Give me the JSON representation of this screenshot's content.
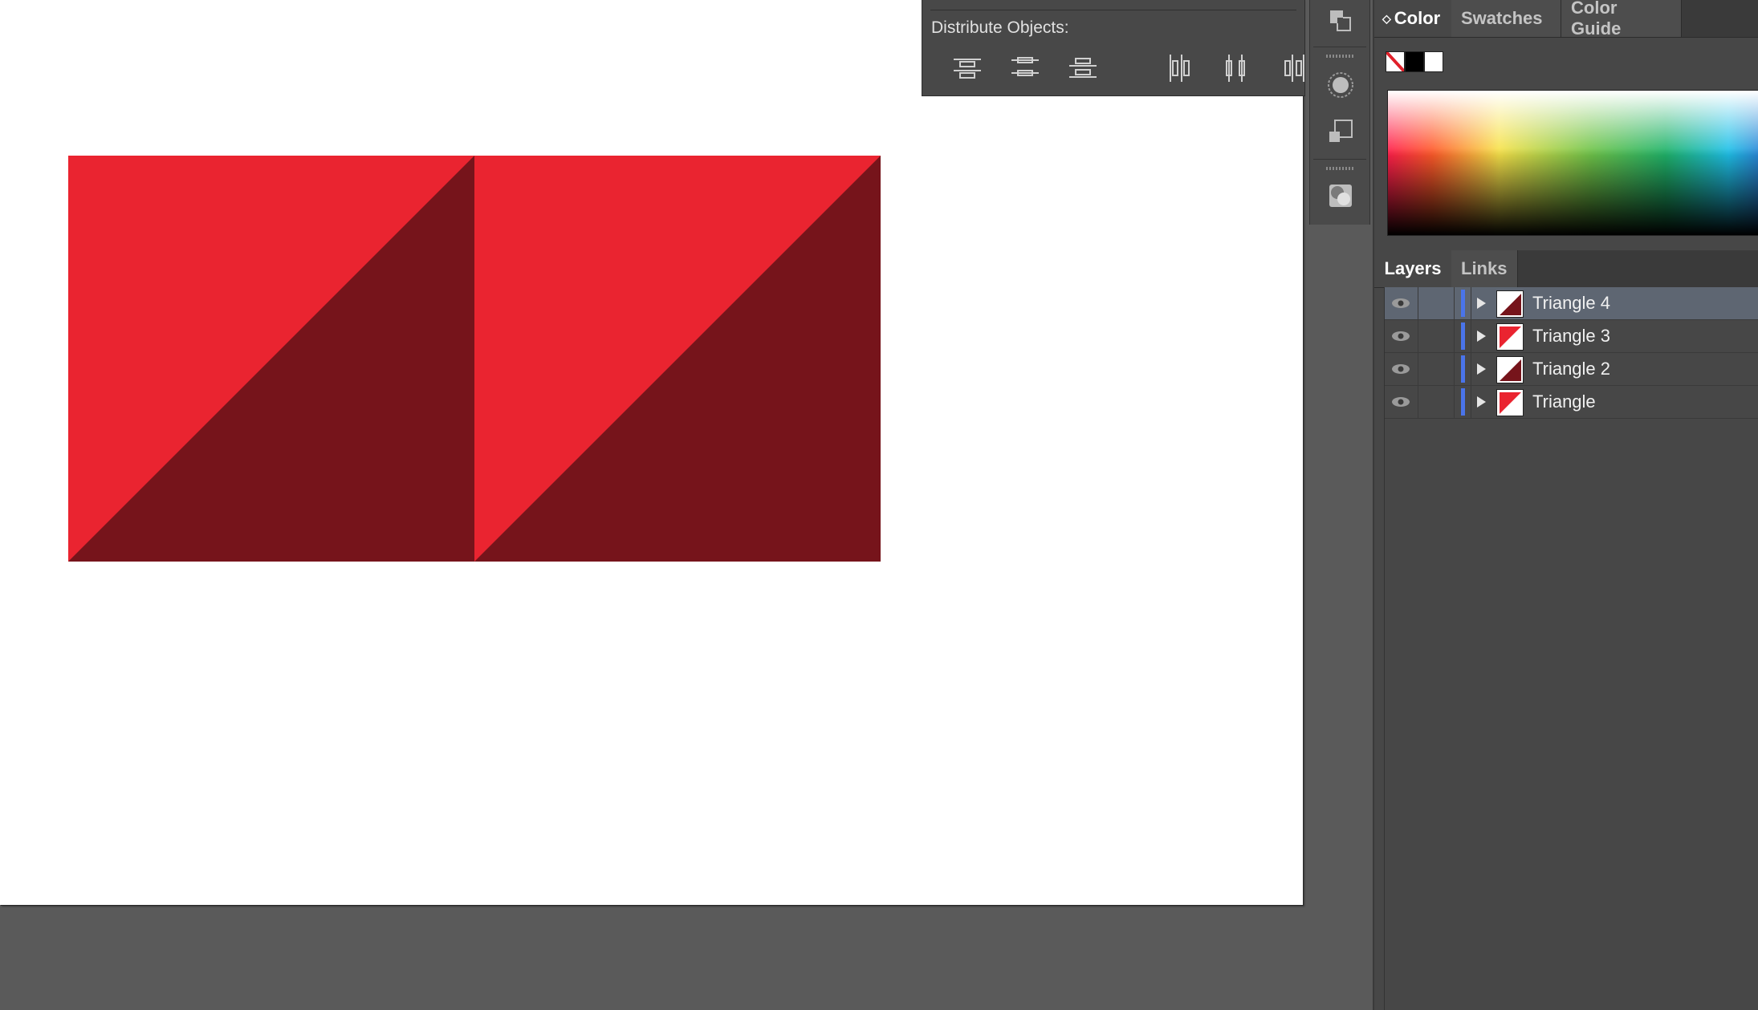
{
  "distribute_panel": {
    "title": "Distribute Objects:",
    "buttons": [
      {
        "name": "vertical-distribute-top",
        "label": "Vertical Distribute Top"
      },
      {
        "name": "vertical-distribute-center",
        "label": "Vertical Distribute Center"
      },
      {
        "name": "vertical-distribute-bottom",
        "label": "Vertical Distribute Bottom"
      },
      {
        "name": "horizontal-distribute-left",
        "label": "Horizontal Distribute Left"
      },
      {
        "name": "horizontal-distribute-center",
        "label": "Horizontal Distribute Center"
      },
      {
        "name": "horizontal-distribute-right",
        "label": "Horizontal Distribute Right"
      }
    ]
  },
  "color_panel": {
    "tabs": [
      "Color",
      "Swatches",
      "Color Guide"
    ],
    "active_tab": "Color",
    "colors": {
      "none": "#ffffff",
      "black": "#000000",
      "white": "#ffffff"
    }
  },
  "layers_panel": {
    "tabs": [
      "Layers",
      "Links"
    ],
    "active_tab": "Layers",
    "layers": [
      {
        "name": "Triangle 4",
        "selected": true,
        "thumb": "dark"
      },
      {
        "name": "Triangle 3",
        "selected": false,
        "thumb": "red"
      },
      {
        "name": "Triangle 2",
        "selected": false,
        "thumb": "dark"
      },
      {
        "name": "Triangle",
        "selected": false,
        "thumb": "red"
      }
    ]
  },
  "artwork": {
    "colors": {
      "light_red": "#ea2430",
      "dark_red": "#76141b"
    }
  }
}
